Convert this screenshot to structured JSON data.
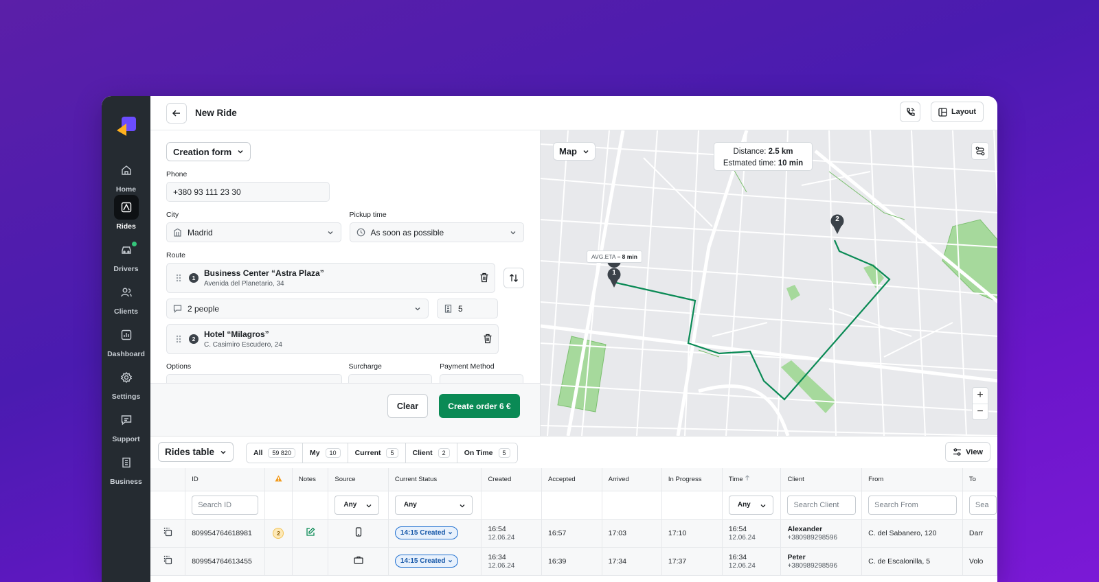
{
  "sidebar": {
    "items": [
      {
        "label": "Home"
      },
      {
        "label": "Rides"
      },
      {
        "label": "Drivers"
      },
      {
        "label": "Clients"
      },
      {
        "label": "Dashboard"
      },
      {
        "label": "Settings"
      },
      {
        "label": "Support"
      },
      {
        "label": "Business"
      }
    ],
    "active": "Rides"
  },
  "topbar": {
    "title": "New Ride",
    "layout_label": "Layout"
  },
  "form": {
    "mode_label": "Creation form",
    "phone_label": "Phone",
    "phone_value": "+380 93 111 23 30",
    "city_label": "City",
    "city_value": "Madrid",
    "pickup_label": "Pickup time",
    "pickup_value": "As soon as possible",
    "route_label": "Route",
    "stops": [
      {
        "num": "1",
        "title": "Business Center “Astra Plaza”",
        "address": "Avenida del Planetario, 34"
      },
      {
        "num": "2",
        "title": "Hotel “Milagros”",
        "address": "C. Casimiro Escudero, 24"
      }
    ],
    "passengers_value": "2 people",
    "floor_value": "5",
    "options_label": "Options",
    "surcharge_label": "Surcharge",
    "payment_label": "Payment Method",
    "clear_label": "Clear",
    "create_label": "Create order 6 €"
  },
  "map": {
    "mode_label": "Map",
    "distance_label": "Distance:",
    "distance_value": "2.5 km",
    "time_label": "Estmated time:",
    "time_value": "10 min",
    "avg_eta_label": "AVG.ETA",
    "avg_eta_value": "– 8 min",
    "pin1": "1",
    "pin2": "2",
    "zoom_in": "+",
    "zoom_out": "−"
  },
  "table": {
    "title": "Rides table",
    "view_label": "View",
    "filters": [
      {
        "label": "All",
        "count": "59 820"
      },
      {
        "label": "My",
        "count": "10"
      },
      {
        "label": "Current",
        "count": "5"
      },
      {
        "label": "Client",
        "count": "2"
      },
      {
        "label": "On Time",
        "count": "5"
      }
    ],
    "headers": {
      "id": "ID",
      "notes": "Notes",
      "source": "Source",
      "status": "Current Status",
      "created": "Created",
      "accepted": "Accepted",
      "arrived": "Arrived",
      "in_progress": "In Progress",
      "time": "Time",
      "client": "Client",
      "from": "From",
      "to": "To"
    },
    "filter_row": {
      "search_id": "Search ID",
      "source_any": "Any",
      "status_any": "Any",
      "time_any": "Any",
      "search_client": "Search Client",
      "search_from": "Search From",
      "search_to": "Sea"
    },
    "rows": [
      {
        "id": "809954764618981",
        "warn": "2",
        "status": "14:15 Created",
        "created_time": "16:54",
        "created_date": "12.06.24",
        "accepted": "16:57",
        "arrived": "17:03",
        "in_progress": "17:10",
        "time": "16:54",
        "time_date": "12.06.24",
        "client_name": "Alexander",
        "client_phone": "+380989298596",
        "from": "C. del Sabanero, 120",
        "to": "Darr"
      },
      {
        "id": "809954764613455",
        "warn": "",
        "status": "14:15 Created",
        "created_time": "16:34",
        "created_date": "12.06.24",
        "accepted": "16:39",
        "arrived": "17:34",
        "in_progress": "17:37",
        "time": "16:34",
        "time_date": "12.06.24",
        "client_name": "Peter",
        "client_phone": "+380989298596",
        "from": "C. de Escalonilla, 5",
        "to": "Volo"
      }
    ]
  },
  "colors": {
    "accent_green": "#0a8a55",
    "status_blue": "#1e6fd0",
    "sidebar_bg": "#252b31"
  }
}
